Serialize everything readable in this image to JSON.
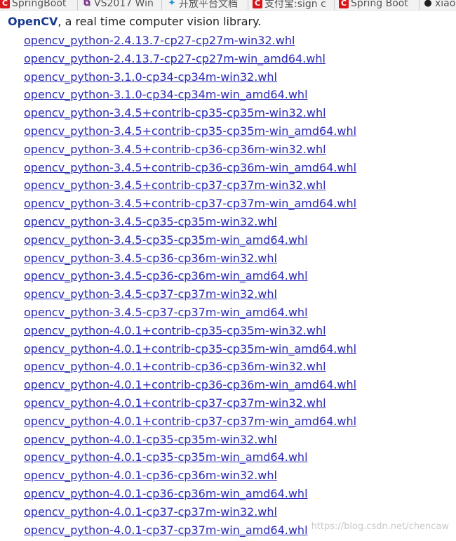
{
  "bookmarks": [
    {
      "label": "SpringBoot",
      "icon": "csdn-icon"
    },
    {
      "label": "VS2017 Win",
      "icon": "vs-icon"
    },
    {
      "label": "开放平台文档",
      "icon": "yuque-icon"
    },
    {
      "label": "支付宝:sign c",
      "icon": "csdn-icon"
    },
    {
      "label": "Spring Boot",
      "icon": "csdn-icon"
    },
    {
      "label": "xiao",
      "icon": "github-icon"
    }
  ],
  "header": {
    "brand": "OpenCV",
    "description": ", a real time computer vision library."
  },
  "files": [
    "opencv_python-2.4.13.7-cp27-cp27m-win32.whl",
    "opencv_python-2.4.13.7-cp27-cp27m-win_amd64.whl",
    "opencv_python-3.1.0-cp34-cp34m-win32.whl",
    "opencv_python-3.1.0-cp34-cp34m-win_amd64.whl",
    "opencv_python-3.4.5+contrib-cp35-cp35m-win32.whl",
    "opencv_python-3.4.5+contrib-cp35-cp35m-win_amd64.whl",
    "opencv_python-3.4.5+contrib-cp36-cp36m-win32.whl",
    "opencv_python-3.4.5+contrib-cp36-cp36m-win_amd64.whl",
    "opencv_python-3.4.5+contrib-cp37-cp37m-win32.whl",
    "opencv_python-3.4.5+contrib-cp37-cp37m-win_amd64.whl",
    "opencv_python-3.4.5-cp35-cp35m-win32.whl",
    "opencv_python-3.4.5-cp35-cp35m-win_amd64.whl",
    "opencv_python-3.4.5-cp36-cp36m-win32.whl",
    "opencv_python-3.4.5-cp36-cp36m-win_amd64.whl",
    "opencv_python-3.4.5-cp37-cp37m-win32.whl",
    "opencv_python-3.4.5-cp37-cp37m-win_amd64.whl",
    "opencv_python-4.0.1+contrib-cp35-cp35m-win32.whl",
    "opencv_python-4.0.1+contrib-cp35-cp35m-win_amd64.whl",
    "opencv_python-4.0.1+contrib-cp36-cp36m-win32.whl",
    "opencv_python-4.0.1+contrib-cp36-cp36m-win_amd64.whl",
    "opencv_python-4.0.1+contrib-cp37-cp37m-win32.whl",
    "opencv_python-4.0.1+contrib-cp37-cp37m-win_amd64.whl",
    "opencv_python-4.0.1-cp35-cp35m-win32.whl",
    "opencv_python-4.0.1-cp35-cp35m-win_amd64.whl",
    "opencv_python-4.0.1-cp36-cp36m-win32.whl",
    "opencv_python-4.0.1-cp36-cp36m-win_amd64.whl",
    "opencv_python-4.0.1-cp37-cp37m-win32.whl",
    "opencv_python-4.0.1-cp37-cp37m-win_amd64.whl"
  ],
  "watermark": "https://blog.csdn.net/chencaw",
  "colors": {
    "link": "#2a2ab8",
    "brand": "#1a3a8f",
    "csdn_red": "#d9141b"
  }
}
